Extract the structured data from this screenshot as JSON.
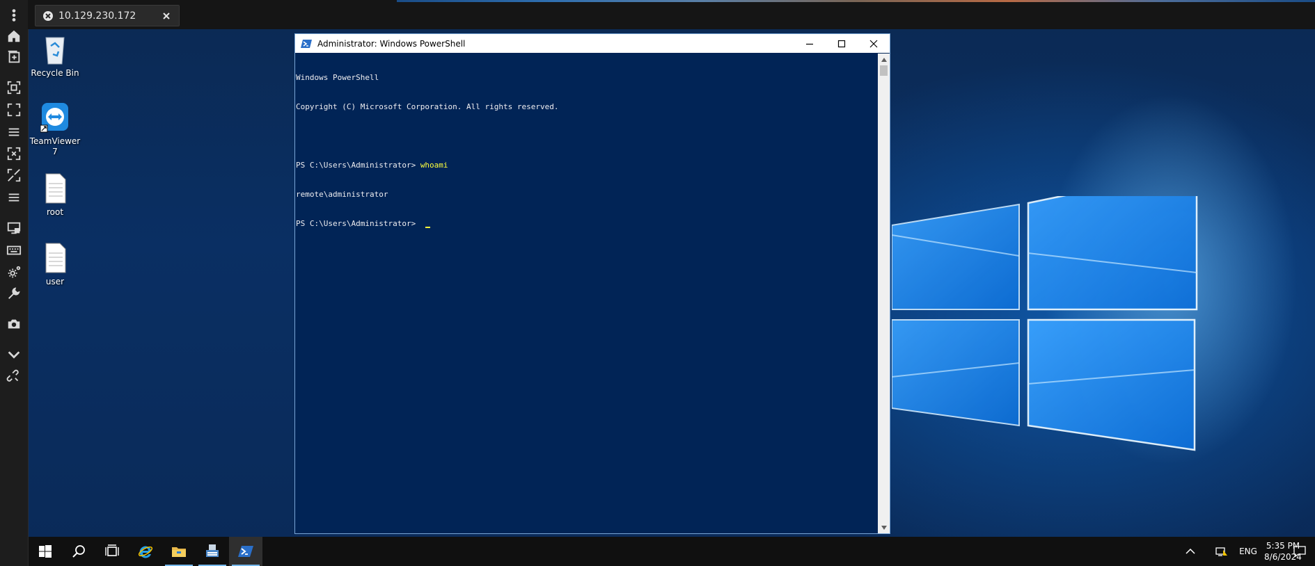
{
  "browser_tab": {
    "title": "10.129.230.172"
  },
  "desktop_icons": [
    {
      "label": "Recycle Bin",
      "icon": "recycle-bin-icon"
    },
    {
      "label": "TeamViewer 7",
      "icon": "teamviewer-icon"
    },
    {
      "label": "root",
      "icon": "text-file-icon"
    },
    {
      "label": "user",
      "icon": "text-file-icon"
    }
  ],
  "powershell": {
    "window_title": "Administrator: Windows PowerShell",
    "lines": [
      {
        "text": "Windows PowerShell"
      },
      {
        "text": "Copyright (C) Microsoft Corporation. All rights reserved."
      },
      {
        "text": ""
      },
      {
        "prompt": "PS C:\\Users\\Administrator> ",
        "command": "whoami"
      },
      {
        "text": "remote\\administrator"
      },
      {
        "prompt": "PS C:\\Users\\Administrator> ",
        "command": ""
      }
    ]
  },
  "taskbar": {
    "items": [
      "start-icon",
      "search-icon",
      "task-view-icon",
      "internet-explorer-icon",
      "file-explorer-icon",
      "server-manager-icon",
      "powershell-icon"
    ],
    "active_item": "powershell-icon"
  },
  "tray": {
    "language": "ENG",
    "time": "5:35 PM",
    "date": "8/6/2024"
  },
  "colors": {
    "powershell_bg": "#012456",
    "command_yellow": "#ffff3c",
    "accent": "#76b9ed"
  }
}
